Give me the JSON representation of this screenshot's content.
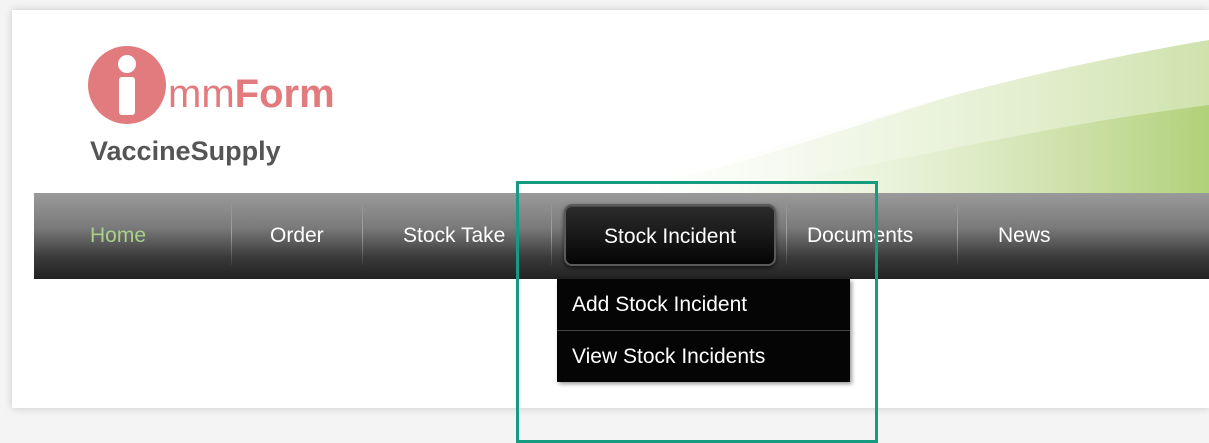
{
  "app": {
    "logo_text_light": "mm",
    "logo_text_bold": "Form",
    "subtitle": "VaccineSupply"
  },
  "nav": {
    "items": [
      {
        "label": "Home",
        "active": true
      },
      {
        "label": "Order",
        "active": false
      },
      {
        "label": "Stock Take",
        "active": false
      },
      {
        "label": "Stock Incident",
        "active": false,
        "hovered": true
      },
      {
        "label": "Documents",
        "active": false
      },
      {
        "label": "News",
        "active": false
      }
    ]
  },
  "dropdown": {
    "items": [
      {
        "label": "Add Stock Incident"
      },
      {
        "label": "View Stock Incidents"
      }
    ]
  },
  "colors": {
    "brand": "#e27b7d",
    "nav_active": "#a8d08a",
    "highlight": "#159b80",
    "subtitle": "#555555"
  },
  "icons": {
    "logo": "immform-i-logo-icon"
  }
}
